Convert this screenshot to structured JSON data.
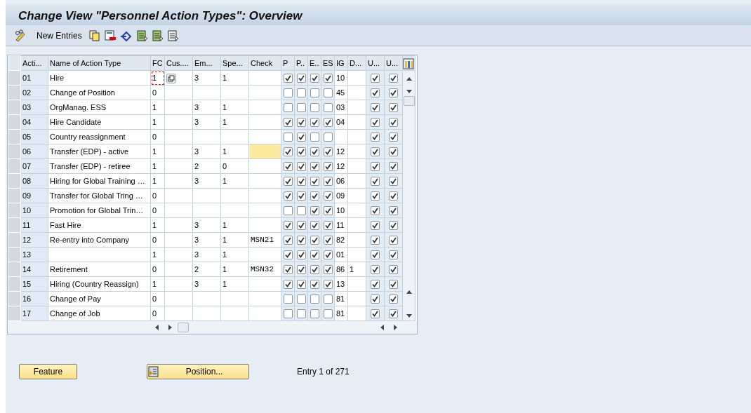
{
  "window": {
    "title": "Change View \"Personnel Action Types\": Overview"
  },
  "toolbar": {
    "new_entries": "New Entries"
  },
  "table": {
    "columns": [
      "Acti...",
      "Name of Action Type",
      "FC",
      "Cus....",
      "Em...",
      "Spe...",
      "Check",
      "P",
      "P..",
      "E..",
      "ES",
      "IG",
      "D...",
      "U...",
      "U..."
    ],
    "rows": [
      {
        "id": "01",
        "name": "Hire",
        "fc": "1",
        "fc_focused": true,
        "em": "3",
        "spe": "1",
        "check": "",
        "check_highlighted": false,
        "flags": [
          true,
          true,
          true,
          true
        ],
        "ig": "10",
        "d": "",
        "u": [
          true,
          true
        ]
      },
      {
        "id": "02",
        "name": "Change of Position",
        "fc": "0",
        "fc_focused": false,
        "em": "",
        "spe": "",
        "check": "",
        "check_highlighted": false,
        "flags": [
          false,
          false,
          false,
          false
        ],
        "ig": "45",
        "d": "",
        "u": [
          true,
          true
        ]
      },
      {
        "id": "03",
        "name": "OrgManag. ESS",
        "fc": "1",
        "fc_focused": false,
        "em": "3",
        "spe": "1",
        "check": "",
        "check_highlighted": false,
        "flags": [
          false,
          false,
          false,
          false
        ],
        "ig": "03",
        "d": "",
        "u": [
          true,
          true
        ]
      },
      {
        "id": "04",
        "name": "Hire Candidate",
        "fc": "1",
        "fc_focused": false,
        "em": "3",
        "spe": "1",
        "check": "",
        "check_highlighted": false,
        "flags": [
          true,
          true,
          true,
          true
        ],
        "ig": "04",
        "d": "",
        "u": [
          true,
          true
        ]
      },
      {
        "id": "05",
        "name": "Country reassignment",
        "fc": "0",
        "fc_focused": false,
        "em": "",
        "spe": "",
        "check": "",
        "check_highlighted": false,
        "flags": [
          false,
          true,
          false,
          false
        ],
        "ig": "",
        "d": "",
        "u": [
          true,
          true
        ]
      },
      {
        "id": "06",
        "name": "Transfer (EDP) - active",
        "fc": "1",
        "fc_focused": false,
        "em": "3",
        "spe": "1",
        "check": "",
        "check_highlighted": true,
        "flags": [
          true,
          true,
          true,
          true
        ],
        "ig": "12",
        "d": "",
        "u": [
          true,
          true
        ]
      },
      {
        "id": "07",
        "name": "Transfer (EDP) - retiree",
        "fc": "1",
        "fc_focused": false,
        "em": "2",
        "spe": "0",
        "check": "",
        "check_highlighted": false,
        "flags": [
          true,
          true,
          true,
          true
        ],
        "ig": "12",
        "d": "",
        "u": [
          true,
          true
        ]
      },
      {
        "id": "08",
        "name": "Hiring for Global Training …",
        "fc": "1",
        "fc_focused": false,
        "em": "3",
        "spe": "1",
        "check": "",
        "check_highlighted": false,
        "flags": [
          true,
          true,
          true,
          true
        ],
        "ig": "06",
        "d": "",
        "u": [
          true,
          true
        ]
      },
      {
        "id": "09",
        "name": "Transfer for Global Tring …",
        "fc": "0",
        "fc_focused": false,
        "em": "",
        "spe": "",
        "check": "",
        "check_highlighted": false,
        "flags": [
          true,
          true,
          true,
          true
        ],
        "ig": "09",
        "d": "",
        "u": [
          true,
          true
        ]
      },
      {
        "id": "10",
        "name": "Promotion for Global Trin…",
        "fc": "0",
        "fc_focused": false,
        "em": "",
        "spe": "",
        "check": "",
        "check_highlighted": false,
        "flags": [
          false,
          false,
          true,
          true
        ],
        "ig": "10",
        "d": "",
        "u": [
          true,
          true
        ]
      },
      {
        "id": "11",
        "name": "Fast Hire",
        "fc": "1",
        "fc_focused": false,
        "em": "3",
        "spe": "1",
        "check": "",
        "check_highlighted": false,
        "flags": [
          true,
          true,
          true,
          true
        ],
        "ig": "11",
        "d": "",
        "u": [
          true,
          true
        ]
      },
      {
        "id": "12",
        "name": "Re-entry into Company",
        "fc": "0",
        "fc_focused": false,
        "em": "3",
        "spe": "1",
        "check": "MSN21",
        "check_highlighted": false,
        "flags": [
          true,
          true,
          true,
          true
        ],
        "ig": "82",
        "d": "",
        "u": [
          true,
          true
        ]
      },
      {
        "id": "13",
        "name": "",
        "fc": "1",
        "fc_focused": false,
        "em": "3",
        "spe": "1",
        "check": "",
        "check_highlighted": false,
        "flags": [
          true,
          true,
          true,
          true
        ],
        "ig": "01",
        "d": "",
        "u": [
          true,
          true
        ]
      },
      {
        "id": "14",
        "name": "Retirement",
        "fc": "0",
        "fc_focused": false,
        "em": "2",
        "spe": "1",
        "check": "MSN32",
        "check_highlighted": false,
        "flags": [
          true,
          true,
          true,
          true
        ],
        "ig": "86",
        "d": "1",
        "u": [
          true,
          true
        ]
      },
      {
        "id": "15",
        "name": "Hiring (Country Reassign)",
        "fc": "1",
        "fc_focused": false,
        "em": "3",
        "spe": "1",
        "check": "",
        "check_highlighted": false,
        "flags": [
          true,
          true,
          true,
          true
        ],
        "ig": "13",
        "d": "",
        "u": [
          true,
          true
        ]
      },
      {
        "id": "16",
        "name": "Change of Pay",
        "fc": "0",
        "fc_focused": false,
        "em": "",
        "spe": "",
        "check": "",
        "check_highlighted": false,
        "flags": [
          false,
          false,
          false,
          false
        ],
        "ig": "81",
        "d": "",
        "u": [
          true,
          true
        ]
      },
      {
        "id": "17",
        "name": "Change of Job",
        "fc": "0",
        "fc_focused": false,
        "em": "",
        "spe": "",
        "check": "",
        "check_highlighted": false,
        "flags": [
          false,
          false,
          false,
          false
        ],
        "ig": "81",
        "d": "",
        "u": [
          true,
          true
        ]
      }
    ]
  },
  "buttons": {
    "feature": "Feature",
    "position": "Position..."
  },
  "entry_info": "Entry 1 of 271"
}
